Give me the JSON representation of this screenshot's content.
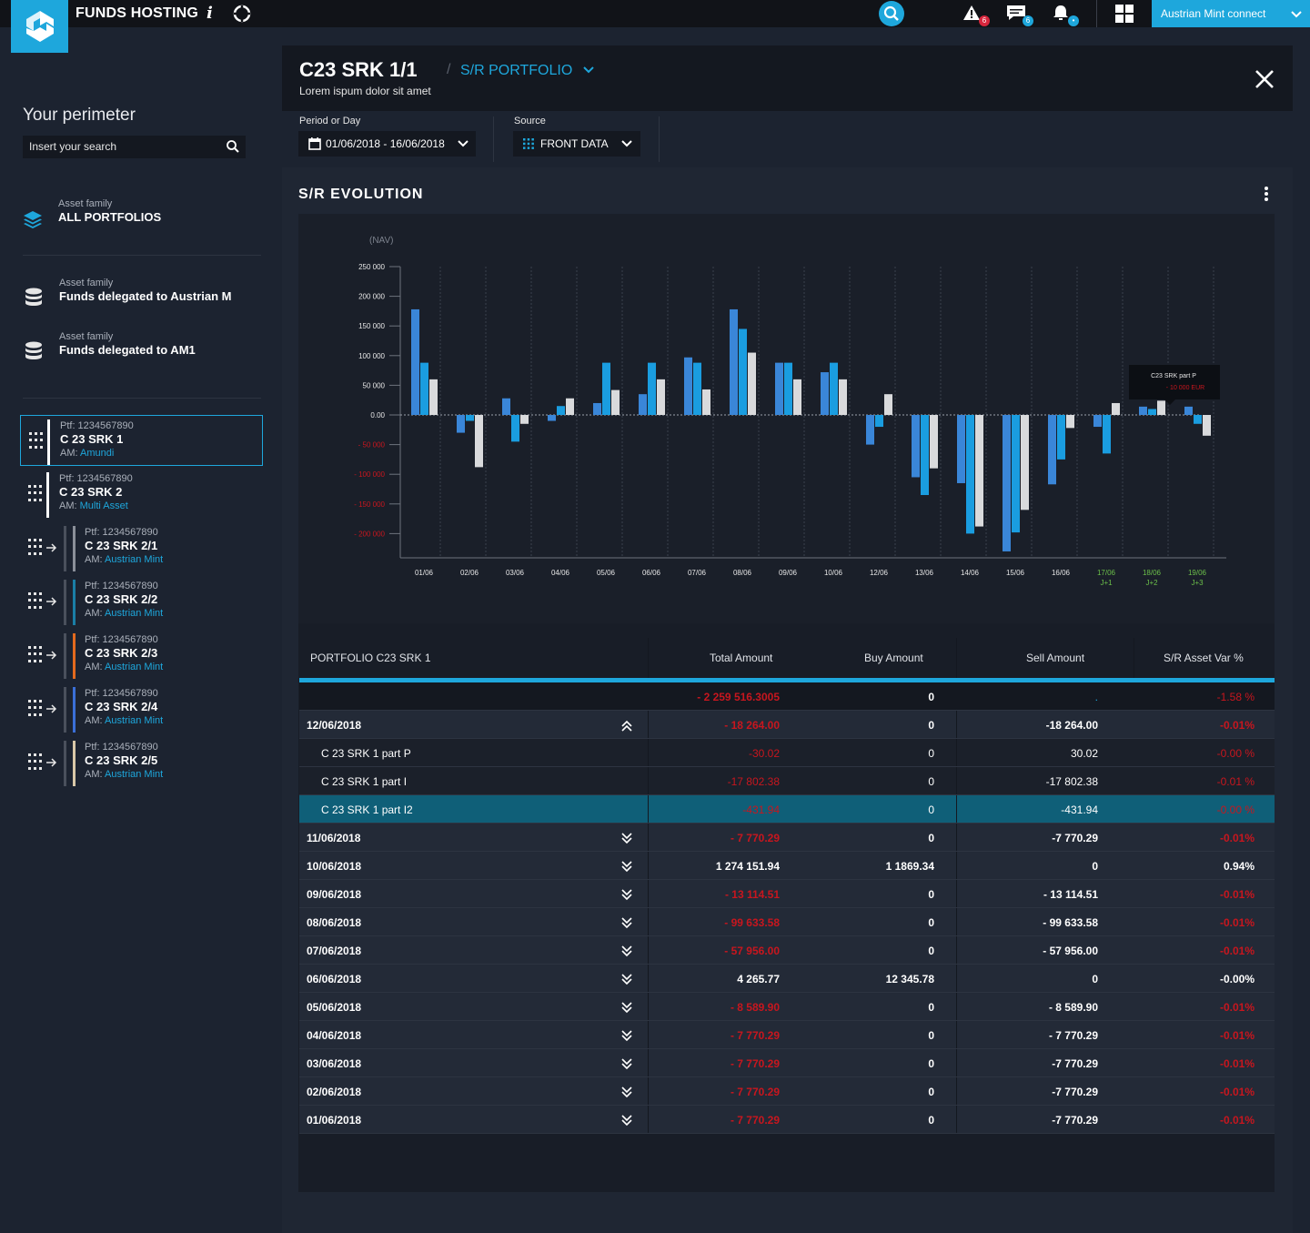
{
  "app": {
    "title": "FUNDS HOSTING",
    "info_glyph": "i"
  },
  "top": {
    "alerts_count": "6",
    "messages_count": "6",
    "notif_dot": "•",
    "user_label": "Austrian Mint connect"
  },
  "sidebar": {
    "title": "Your perimeter",
    "search_placeholder": "Insert your search",
    "families": [
      {
        "label": "Asset family",
        "value": "ALL PORTFOLIOS"
      },
      {
        "label": "Asset family",
        "value": "Funds delegated to Austrian M"
      },
      {
        "label": "Asset family",
        "value": "Funds delegated to AM1"
      }
    ],
    "portfolios": [
      {
        "ptf": "Ptf:  1234567890",
        "name": "C 23 SRK 1",
        "am_label": "AM:",
        "am": "Amundi",
        "color": "#ffffff"
      },
      {
        "ptf": "Ptf:  1234567890",
        "name": "C 23 SRK 2",
        "am_label": "AM:",
        "am": "Multi Asset",
        "color": "#ffffff"
      },
      {
        "ptf": "Ptf:  1234567890",
        "name": "C 23 SRK 2/1",
        "am_label": "AM:",
        "am": "Austrian Mint",
        "color": "#8a8f99"
      },
      {
        "ptf": "Ptf:  1234567890",
        "name": "C 23 SRK 2/2",
        "am_label": "AM:",
        "am": "Austrian Mint",
        "color": "#1a7ea6"
      },
      {
        "ptf": "Ptf:  1234567890",
        "name": "C 23 SRK 2/3",
        "am_label": "AM:",
        "am": "Austrian Mint",
        "color": "#e36a1e"
      },
      {
        "ptf": "Ptf:  1234567890",
        "name": "C 23 SRK 2/4",
        "am_label": "AM:",
        "am": "Austrian Mint",
        "color": "#3a6fd8"
      },
      {
        "ptf": "Ptf:  1234567890",
        "name": "C 23 SRK 2/5",
        "am_label": "AM:",
        "am": "Austrian Mint",
        "color": "#d9c8a8"
      }
    ]
  },
  "header": {
    "title": "C23 SRK 1/1",
    "slash": "/",
    "subtitle": "S/R PORTFOLIO",
    "description": "Lorem ispum dolor sit amet"
  },
  "filters": {
    "period_label": "Period or Day",
    "period_value": "01/06/2018 - 16/06/2018",
    "source_label": "Source",
    "source_value": "FRONT DATA"
  },
  "panel": {
    "title": "S/R EVOLUTION"
  },
  "chart_data": {
    "type": "bar",
    "ylabel": "(NAV)",
    "y_ticks": [
      "250 000",
      "200 000",
      "150 000",
      "100 000",
      "50 000",
      "0.00",
      "- 50 000",
      "- 100 000",
      "- 150 000",
      "- 200 000"
    ],
    "ylim": [
      -250000,
      250000
    ],
    "categories": [
      "01/06",
      "02/06",
      "03/06",
      "04/06",
      "05/06",
      "06/06",
      "07/06",
      "08/06",
      "09/06",
      "10/06",
      "12/06",
      "13/06",
      "14/06",
      "15/06",
      "16/06",
      "17/06",
      "18/06",
      "19/06"
    ],
    "category_sub": [
      "",
      "",
      "",
      "",
      "",
      "",
      "",
      "",
      "",
      "",
      "",
      "",
      "",
      "",
      "",
      "J+1",
      "J+2",
      "J+3"
    ],
    "series": [
      {
        "values": [
          178000,
          -30000,
          28000,
          -10000,
          20000,
          35000,
          97000,
          178000,
          88000,
          72000,
          -50000,
          -105000,
          -115000,
          -230000,
          -117000,
          -20000,
          14000,
          14000
        ],
        "color": "#3a86d8"
      },
      {
        "values": [
          88000,
          -10000,
          -45000,
          15000,
          88000,
          88000,
          88000,
          145000,
          88000,
          88000,
          -20000,
          -135000,
          -200000,
          -198000,
          -75000,
          -65000,
          10000,
          -15000
        ],
        "color": "#1a9de0"
      },
      {
        "values": [
          60000,
          -88000,
          -15000,
          28000,
          42000,
          60000,
          43000,
          105000,
          60000,
          60000,
          35000,
          -90000,
          -188000,
          -160000,
          -22000,
          20000,
          24000,
          -35000
        ],
        "color": "#d9dadc"
      }
    ],
    "tooltip": {
      "title": "C23 SRK part  P",
      "value": "- 10 000 EUR"
    }
  },
  "table": {
    "headers": [
      "PORTFOLIO C23 SRK 1",
      "Total Amount",
      "Buy  Amount",
      "Sell Amount",
      "S/R Asset  Var %"
    ],
    "total": {
      "total": "- 2 259 516.3005",
      "buy": "0",
      "sell": ".",
      "var": "-1.58  %"
    },
    "rows": [
      {
        "kind": "date",
        "label": "12/06/2018",
        "total": "- 18 264.00",
        "buy": "0",
        "sell": "-18 264.00",
        "var": "-0.01%",
        "total_neg": true,
        "var_neg": true,
        "expanded": true
      },
      {
        "kind": "sub",
        "label": "C 23 SRK 1 part P",
        "total": "-30.02",
        "buy": "0",
        "sell": "30.02",
        "var": "-0.00  %",
        "total_neg": true,
        "var_neg": true
      },
      {
        "kind": "sub",
        "label": "C 23 SRK 1 part I",
        "total": "-17 802.38",
        "buy": "0",
        "sell": "-17 802.38",
        "var": "-0.01  %",
        "total_neg": true,
        "var_neg": true
      },
      {
        "kind": "hl",
        "label": "C 23 SRK 1 part I2",
        "total": "-431.94",
        "buy": "0",
        "sell": "-431.94",
        "var": "-0.00  %",
        "total_neg": true,
        "var_neg": true
      },
      {
        "kind": "date",
        "label": "11/06/2018",
        "total": "- 7 770.29",
        "buy": "0",
        "sell": "-7 770.29",
        "var": "-0.01%",
        "total_neg": true,
        "var_neg": true
      },
      {
        "kind": "date",
        "label": "10/06/2018",
        "total": "1 274 151.94",
        "buy": "1 1869.34",
        "sell": "0",
        "var": "0.94%",
        "total_neg": false,
        "var_neg": false
      },
      {
        "kind": "date",
        "label": "09/06/2018",
        "total": "- 13 114.51",
        "buy": "0",
        "sell": "- 13 114.51",
        "var": "-0.01%",
        "total_neg": true,
        "var_neg": true
      },
      {
        "kind": "date",
        "label": "08/06/2018",
        "total": "- 99 633.58",
        "buy": "0",
        "sell": "- 99 633.58",
        "var": "-0.01%",
        "total_neg": true,
        "var_neg": true
      },
      {
        "kind": "date",
        "label": "07/06/2018",
        "total": "- 57 956.00",
        "buy": "0",
        "sell": "- 57 956.00",
        "var": "-0.01%",
        "total_neg": true,
        "var_neg": true
      },
      {
        "kind": "date",
        "label": "06/06/2018",
        "total": "4 265.77",
        "buy": "12 345.78",
        "sell": "0",
        "var": "-0.00%",
        "total_neg": false,
        "var_neg": false
      },
      {
        "kind": "date",
        "label": "05/06/2018",
        "total": "- 8 589.90",
        "buy": "0",
        "sell": "- 8 589.90",
        "var": "-0.01%",
        "total_neg": true,
        "var_neg": true
      },
      {
        "kind": "date",
        "label": "04/06/2018",
        "total": "- 7 770.29",
        "buy": "0",
        "sell": "- 7 770.29",
        "var": "-0.01%",
        "total_neg": true,
        "var_neg": true
      },
      {
        "kind": "date",
        "label": "03/06/2018",
        "total": "- 7 770.29",
        "buy": "0",
        "sell": "-7 770.29",
        "var": "-0.01%",
        "total_neg": true,
        "var_neg": true
      },
      {
        "kind": "date",
        "label": "02/06/2018",
        "total": "- 7 770.29",
        "buy": "0",
        "sell": "-7 770.29",
        "var": "-0.01%",
        "total_neg": true,
        "var_neg": true
      },
      {
        "kind": "date",
        "label": "01/06/2018",
        "total": "- 7 770.29",
        "buy": "0",
        "sell": "-7 770.29",
        "var": "-0.01%",
        "total_neg": true,
        "var_neg": true
      }
    ]
  },
  "colors": {
    "accent": "#1ea7dc",
    "negative": "#c8161e",
    "future_label": "#6cc04a"
  }
}
